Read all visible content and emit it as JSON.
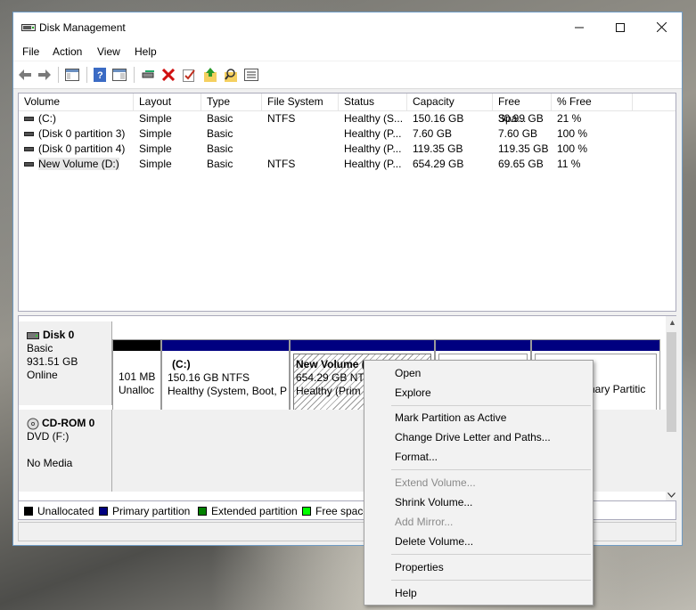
{
  "window": {
    "title": "Disk Management"
  },
  "menu": [
    "File",
    "Action",
    "View",
    "Help"
  ],
  "toolbar": {
    "icons": [
      "back-icon",
      "forward-icon",
      "console-tree-icon",
      "help-icon",
      "show-pane-icon",
      "connect-icon",
      "delete-icon",
      "check-icon",
      "up-icon",
      "find-icon",
      "properties-list-icon"
    ]
  },
  "volume_list": {
    "columns": [
      "Volume",
      "Layout",
      "Type",
      "File System",
      "Status",
      "Capacity",
      "Free Spa...",
      "% Free"
    ],
    "rows": [
      [
        "(C:)",
        "Simple",
        "Basic",
        "NTFS",
        "Healthy (S...",
        "150.16 GB",
        "30.99 GB",
        "21 %"
      ],
      [
        "(Disk 0 partition 3)",
        "Simple",
        "Basic",
        "",
        "Healthy (P...",
        "7.60 GB",
        "7.60 GB",
        "100 %"
      ],
      [
        "(Disk 0 partition 4)",
        "Simple",
        "Basic",
        "",
        "Healthy (P...",
        "119.35 GB",
        "119.35 GB",
        "100 %"
      ],
      [
        "New Volume (D:)",
        "Simple",
        "Basic",
        "NTFS",
        "Healthy (P...",
        "654.29 GB",
        "69.65 GB",
        "11 %"
      ]
    ]
  },
  "disks": {
    "disk0": {
      "name": "Disk 0",
      "type": "Basic",
      "size": "931.51 GB",
      "status": "Online"
    },
    "cdrom0": {
      "name": "CD-ROM 0",
      "type": "DVD (F:)",
      "status": "No Media"
    }
  },
  "partitions": {
    "unalloc": {
      "size": "101 MB",
      "label": "Unalloc"
    },
    "c": {
      "name": "(C:)",
      "size": "150.16 GB NTFS",
      "status": "Healthy (System, Boot, P"
    },
    "d": {
      "name": "New Volume  (D:)",
      "size": "654.29 GB NTF",
      "status": "Healthy (Prim"
    },
    "p5": {
      "status": "rimary Partitic"
    }
  },
  "legend": [
    {
      "label": "Unallocated",
      "color": "#000000"
    },
    {
      "label": "Primary partition",
      "color": "#000080"
    },
    {
      "label": "Extended partition",
      "color": "#008000"
    },
    {
      "label": "Free space",
      "color": "#00ff00"
    }
  ],
  "context_menu": {
    "open": "Open",
    "explore": "Explore",
    "mark_active": "Mark Partition as Active",
    "change_letter": "Change Drive Letter and Paths...",
    "format": "Format...",
    "extend": "Extend Volume...",
    "shrink": "Shrink Volume...",
    "add_mirror": "Add Mirror...",
    "delete": "Delete Volume...",
    "properties": "Properties",
    "help": "Help"
  }
}
